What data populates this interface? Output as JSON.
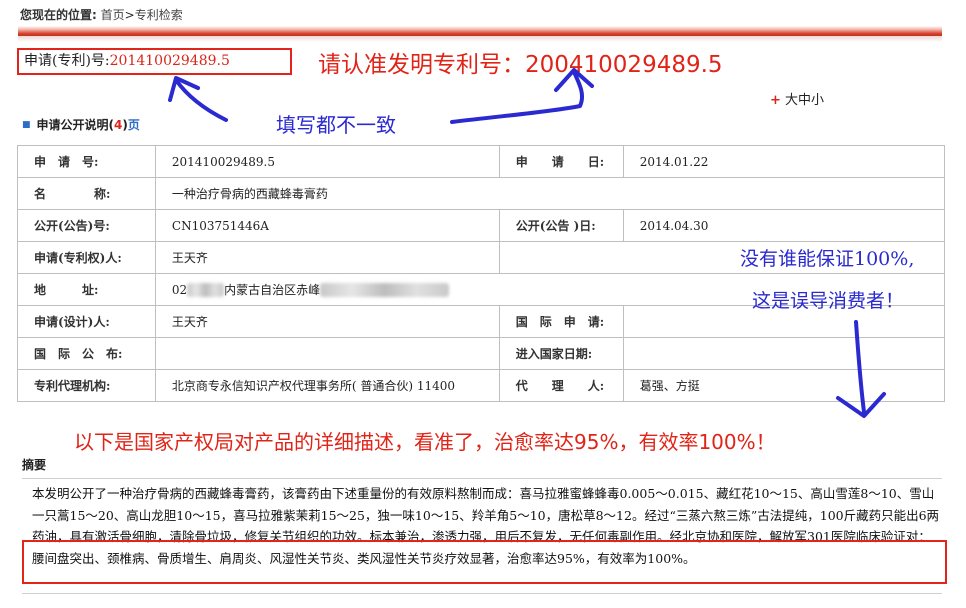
{
  "breadcrumb": {
    "label": "您现在的位置:",
    "home": "首页",
    "sep": ">",
    "current": "专利检索"
  },
  "application_box": {
    "label": "申请(专利)号:",
    "number": "201410029489.5"
  },
  "font_size_control": {
    "icon": "plus-icon",
    "label": "大中小"
  },
  "publication": {
    "title": "申请公开说明",
    "open_paren": "(",
    "pages": "4",
    "close_paren": ")",
    "unit": "页"
  },
  "info_table": {
    "app_no_label": "申　请　号:",
    "app_no": "201410029489.5",
    "app_date_label": "申　　请　　日:",
    "app_date": "2014.01.22",
    "name_label": "名　　　　称:",
    "name": "一种治疗骨病的西藏蜂毒膏药",
    "pub_no_label": "公开(公告)号:",
    "pub_no": "CN103751446A",
    "pub_date_label": "公开(公告 )日:",
    "pub_date": "2014.04.30",
    "applicant_label": "申请(专利权)人:",
    "applicant": "王天齐",
    "address_label": "地　　　址:",
    "address_prefix": "02",
    "address_visible": "内蒙古自治区赤峰",
    "designer_label": "申请(设计)人:",
    "designer": "王天齐",
    "intl_app_label": "国　际　申　请:",
    "intl_app": "",
    "intl_pub_label": "国　际　公　布:",
    "intl_pub": "",
    "nat_phase_label": "进入国家日期:",
    "nat_phase": "",
    "agency_label": "专利代理机构:",
    "agency": "北京商专永信知识产权代理事务所( 普通合伙) 11400",
    "agent_label": "代　　理　　人:",
    "agent": "葛强、方挺"
  },
  "abstract": {
    "heading": "摘要",
    "text": "本发明公开了一种治疗骨病的西藏蜂毒膏药，该膏药由下述重量份的有效原料熬制而成：喜马拉雅蜜蜂蜂毒0.005～0.015、藏红花10～15、高山雪莲8～10、雪山一只蒿15～20、高山龙胆10～15，喜马拉雅紫茉莉15～25，独一味10～15、羚羊角5～10，唐松草8～12。经过“三蒸六熬三炼”古法提纯，100斤藏药只能出6两药油，具有激活骨细胞，清除骨垃圾，修复关节组织的功效。标本兼治，渗透力强，用后不复发，无任何毒副作用。经北京协和医院，解放军301医院临床验证对：腰间盘突出、颈椎病、骨质增生、肩周炎、风湿性关节炎、类风湿性关节炎疗效显著，治愈率达95%，有效率为100%。"
  },
  "annotations": {
    "top_right": "请认准发明专利号：200410029489.5",
    "mismatch": "填写都不一致",
    "no_guarantee": "没有谁能保证100%,",
    "misleading": "这是误导消费者！",
    "claim": "以下是国家产权局对产品的详细描述，看准了，治愈率达95%，有效率100%！",
    "colors": {
      "red": "#e02418",
      "blue": "#2a2ad0"
    }
  }
}
